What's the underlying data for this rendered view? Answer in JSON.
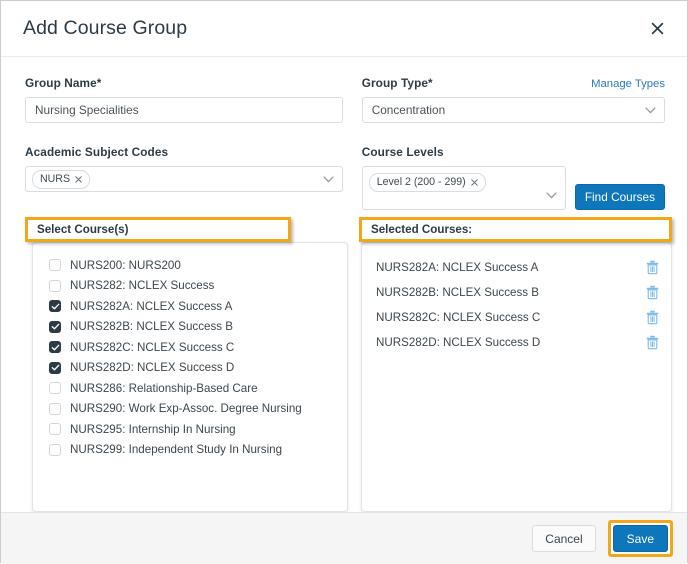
{
  "dialog": {
    "title": "Add Course Group",
    "close_icon": "close-icon"
  },
  "form": {
    "group_name": {
      "label": "Group Name*",
      "value": "Nursing Specialities",
      "placeholder": ""
    },
    "group_type": {
      "label": "Group Type*",
      "value": "Concentration",
      "manage_link": "Manage Types"
    },
    "academic_subject_codes": {
      "label": "Academic Subject Codes",
      "chips": [
        "NURS"
      ]
    },
    "course_levels": {
      "label": "Course Levels",
      "chips": [
        "Level 2 (200 - 299)"
      ],
      "find_button": "Find Courses"
    }
  },
  "select_courses": {
    "header": "Select Course(s)",
    "courses": [
      {
        "label": "NURS200: NURS200",
        "checked": false
      },
      {
        "label": "NURS282: NCLEX Success",
        "checked": false
      },
      {
        "label": "NURS282A: NCLEX Success A",
        "checked": true
      },
      {
        "label": "NURS282B: NCLEX Success B",
        "checked": true
      },
      {
        "label": "NURS282C: NCLEX Success C",
        "checked": true
      },
      {
        "label": "NURS282D: NCLEX Success D",
        "checked": true
      },
      {
        "label": "NURS286: Relationship-Based Care",
        "checked": false
      },
      {
        "label": "NURS290: Work Exp-Assoc. Degree Nursing",
        "checked": false
      },
      {
        "label": "NURS295: Internship In Nursing",
        "checked": false
      },
      {
        "label": "NURS299: Independent Study In Nursing",
        "checked": false
      }
    ]
  },
  "selected_courses": {
    "header": "Selected Courses:",
    "items": [
      {
        "label": "NURS282A: NCLEX Success A",
        "delete_icon": "trash-icon"
      },
      {
        "label": "NURS282B: NCLEX Success B",
        "delete_icon": "trash-icon"
      },
      {
        "label": "NURS282C: NCLEX Success C",
        "delete_icon": "trash-icon"
      },
      {
        "label": "NURS282D: NCLEX Success D",
        "delete_icon": "trash-icon"
      }
    ]
  },
  "footer": {
    "cancel": "Cancel",
    "save": "Save"
  },
  "colors": {
    "highlight": "#f2a71b",
    "primary_blue": "#0e76ba",
    "link_blue": "#2a7ab9",
    "checkbox_checked": "#2d3b45",
    "trash_blue": "#7fbbe8",
    "text": "#2d3b45"
  }
}
